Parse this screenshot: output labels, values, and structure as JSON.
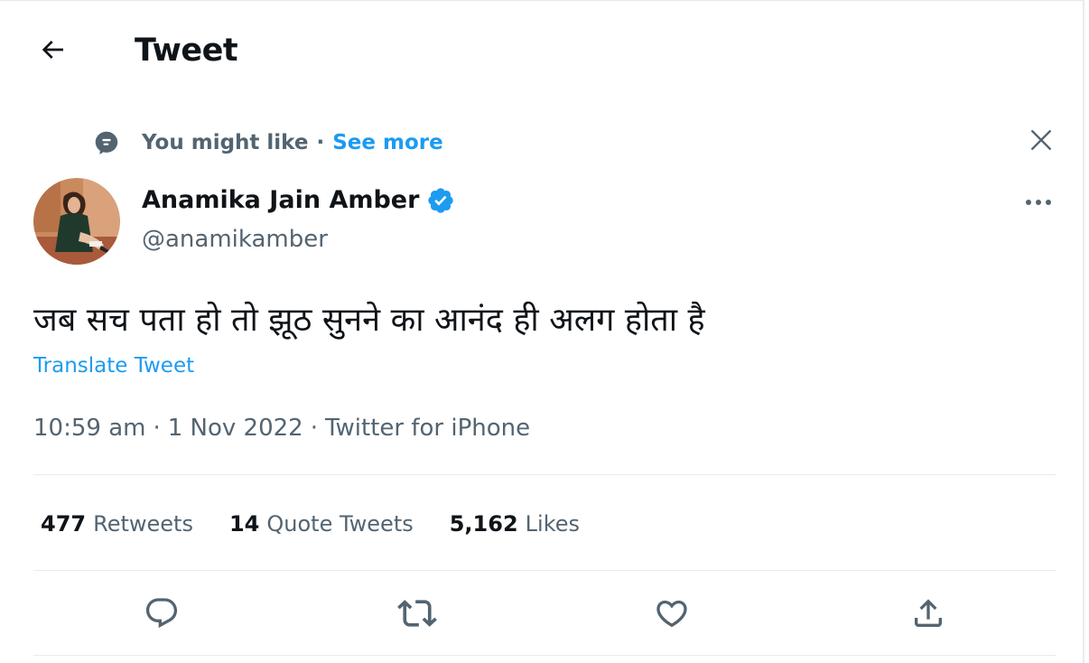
{
  "header": {
    "title": "Tweet",
    "back_icon": "back-arrow-icon"
  },
  "context": {
    "icon": "speech-bubble-icon",
    "label": "You might like",
    "separator": "·",
    "see_more": "See more",
    "close_icon": "close-icon"
  },
  "author": {
    "name": "Anamika Jain Amber",
    "handle": "@anamikamber",
    "verified_icon": "verified-badge-icon",
    "verified_color": "#1d9bf0",
    "more_icon": "more-horizontal-icon"
  },
  "tweet": {
    "text": "जब सच पता हो तो झूठ सुनने का आनंद ही अलग होता है",
    "translate_label": "Translate Tweet",
    "time": "10:59 am",
    "date": "1 Nov 2022",
    "source": "Twitter for iPhone",
    "separator": "·"
  },
  "stats": {
    "retweets": {
      "count": "477",
      "label": "Retweets"
    },
    "quotes": {
      "count": "14",
      "label": "Quote Tweets"
    },
    "likes": {
      "count": "5,162",
      "label": "Likes"
    }
  },
  "actions": {
    "reply_icon": "reply-icon",
    "retweet_icon": "retweet-icon",
    "like_icon": "heart-icon",
    "share_icon": "share-icon"
  },
  "colors": {
    "accent": "#1d9bf0",
    "text_primary": "#0f1419",
    "text_secondary": "#536471",
    "divider": "#e6ecf0"
  }
}
